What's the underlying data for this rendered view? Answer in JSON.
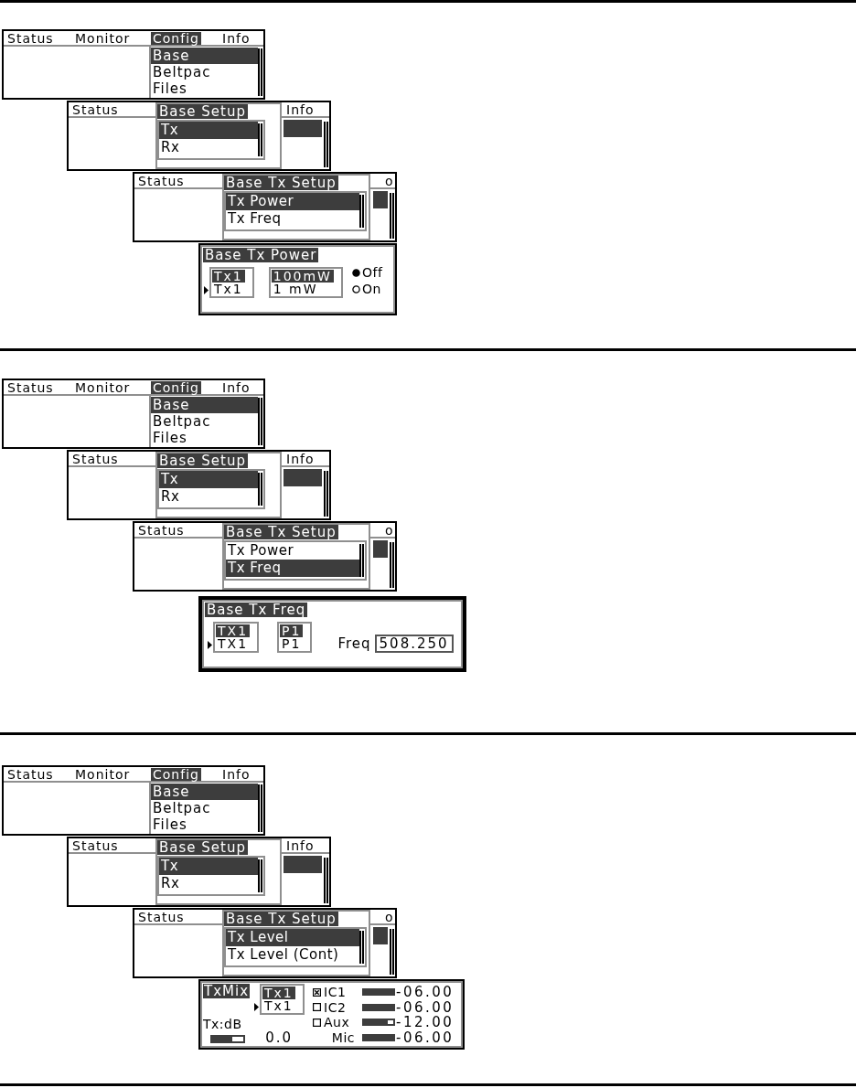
{
  "sections": [
    {
      "screens": [
        {
          "kind": "menu",
          "menubar": [
            {
              "label": "Status",
              "selected": false
            },
            {
              "label": "Monitor",
              "selected": false
            },
            {
              "label": "Config",
              "selected": true
            },
            {
              "label": "Info",
              "selected": false
            }
          ],
          "dropdown": [
            {
              "label": "Base",
              "selected": true
            },
            {
              "label": "Beltpac",
              "selected": false
            },
            {
              "label": "Files",
              "selected": false
            }
          ]
        },
        {
          "kind": "popup",
          "menubar_left": "Status",
          "menubar_right": "Info",
          "title": "Base Setup",
          "items": [
            {
              "label": "Tx",
              "selected": true
            },
            {
              "label": "Rx",
              "selected": false
            }
          ]
        },
        {
          "kind": "popup",
          "menubar_left": "Status",
          "menubar_right": "o",
          "title": "Base Tx Setup",
          "items": [
            {
              "label": "Tx Power",
              "selected": true
            },
            {
              "label": "Tx Freq",
              "selected": false
            }
          ]
        },
        {
          "kind": "tx_power",
          "title": "Base Tx Power",
          "fields": [
            {
              "header": "Tx1",
              "value": "Tx1",
              "focused": true
            },
            {
              "header": "100mW",
              "value": "1 mW",
              "focused": false
            }
          ],
          "options": [
            {
              "label": "Off",
              "selected": true
            },
            {
              "label": "On",
              "selected": false
            }
          ]
        }
      ]
    },
    {
      "screens": [
        {
          "kind": "menu",
          "menubar": [
            {
              "label": "Status",
              "selected": false
            },
            {
              "label": "Monitor",
              "selected": false
            },
            {
              "label": "Config",
              "selected": true
            },
            {
              "label": "Info",
              "selected": false
            }
          ],
          "dropdown": [
            {
              "label": "Base",
              "selected": true
            },
            {
              "label": "Beltpac",
              "selected": false
            },
            {
              "label": "Files",
              "selected": false
            }
          ]
        },
        {
          "kind": "popup",
          "menubar_left": "Status",
          "menubar_right": "Info",
          "title": "Base Setup",
          "items": [
            {
              "label": "Tx",
              "selected": true
            },
            {
              "label": "Rx",
              "selected": false
            }
          ]
        },
        {
          "kind": "popup",
          "menubar_left": "Status",
          "menubar_right": "o",
          "title": "Base Tx Setup",
          "items": [
            {
              "label": "Tx Power",
              "selected": false
            },
            {
              "label": "Tx Freq",
              "selected": true
            }
          ]
        },
        {
          "kind": "tx_freq",
          "title": "Base Tx Freq",
          "fields": [
            {
              "header": "TX1",
              "value": "TX1",
              "focused": true
            },
            {
              "header": "P1",
              "value": "P1",
              "focused": false
            }
          ],
          "freq": {
            "label": "Freq",
            "value": "508.250"
          }
        }
      ]
    },
    {
      "screens": [
        {
          "kind": "menu",
          "menubar": [
            {
              "label": "Status",
              "selected": false
            },
            {
              "label": "Monitor",
              "selected": false
            },
            {
              "label": "Config",
              "selected": true
            },
            {
              "label": "Info",
              "selected": false
            }
          ],
          "dropdown": [
            {
              "label": "Base",
              "selected": true
            },
            {
              "label": "Beltpac",
              "selected": false
            },
            {
              "label": "Files",
              "selected": false
            }
          ]
        },
        {
          "kind": "popup",
          "menubar_left": "Status",
          "menubar_right": "Info",
          "title": "Base Setup",
          "items": [
            {
              "label": "Tx",
              "selected": true
            },
            {
              "label": "Rx",
              "selected": false
            }
          ]
        },
        {
          "kind": "popup",
          "menubar_left": "Status",
          "menubar_right": "o",
          "title": "Base Tx Setup",
          "items": [
            {
              "label": "Tx Level",
              "selected": true
            },
            {
              "label": "Tx Level (Cont)",
              "selected": false
            }
          ]
        },
        {
          "kind": "tx_mix",
          "title": "TxMix",
          "gain": {
            "label": "Tx:dB",
            "level": 0.65,
            "reading": "0.0"
          },
          "fields": [
            {
              "header": "Tx1",
              "value": "Tx1",
              "focused": true
            }
          ],
          "channels": [
            {
              "kind": "checkbox",
              "label": "IC1",
              "checked": true,
              "level": 1,
              "reading": "-06.00"
            },
            {
              "kind": "checkbox",
              "label": "IC2",
              "checked": false,
              "level": 1,
              "reading": "-06.00"
            },
            {
              "kind": "checkbox",
              "label": "Aux",
              "checked": false,
              "level": 0.82,
              "reading": "-12.00"
            },
            {
              "kind": "plain",
              "label": "Mic",
              "level": 1,
              "reading": "-06.00"
            }
          ]
        }
      ]
    }
  ]
}
